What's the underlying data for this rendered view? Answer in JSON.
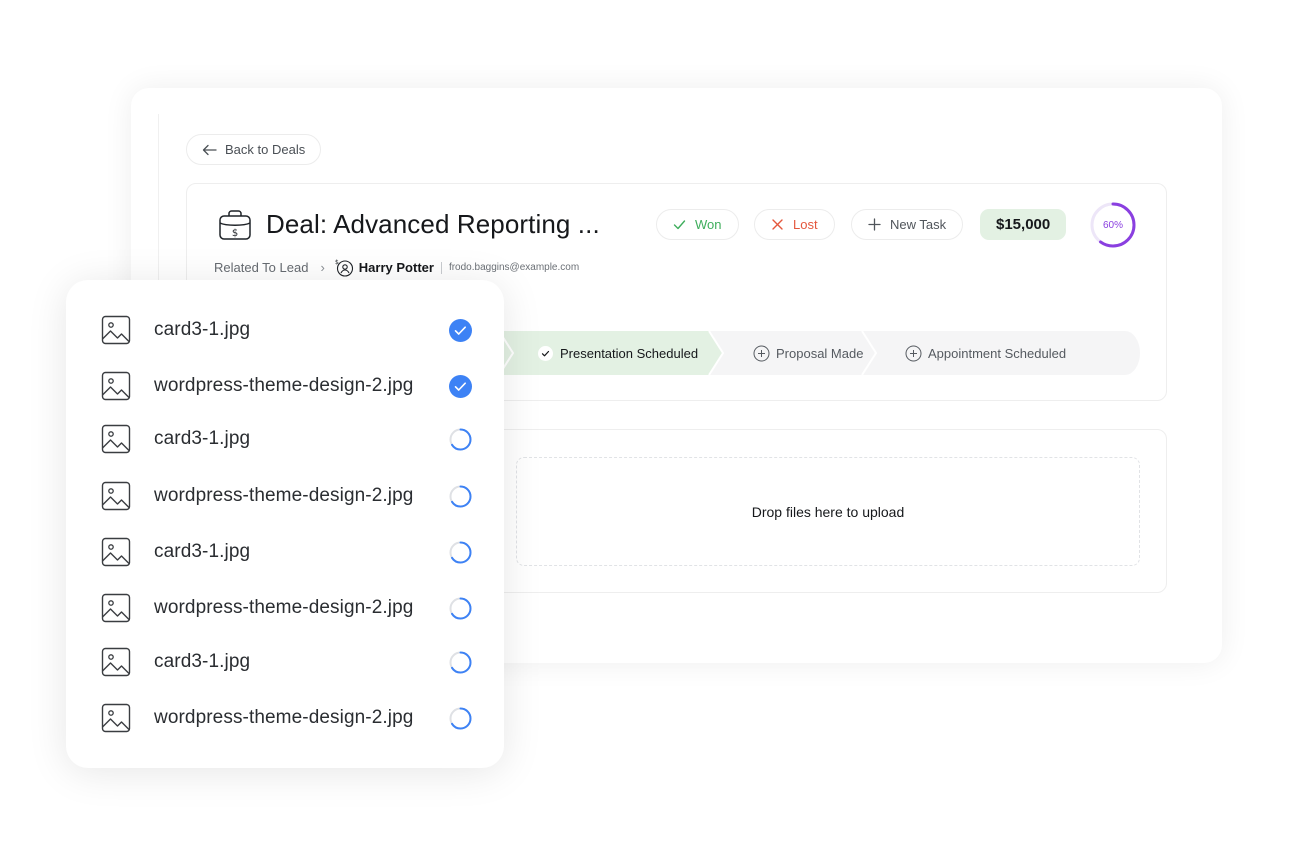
{
  "back": {
    "label": "Back to Deals"
  },
  "deal": {
    "title": "Deal: Advanced Reporting ...",
    "won_label": "Won",
    "lost_label": "Lost",
    "new_task_label": "New Task",
    "amount": "$15,000",
    "progress_label": "60%",
    "progress_fraction": 0.6
  },
  "related": {
    "prefix": "Related To Lead",
    "name": "Harry Potter",
    "email": "frodo.baggins@example.com"
  },
  "stages": [
    {
      "label": "Presentation Scheduled",
      "state": "done"
    },
    {
      "label": "Proposal Made",
      "state": "todo"
    },
    {
      "label": "Appointment Scheduled",
      "state": "todo"
    }
  ],
  "upload": {
    "drop_text": "Drop files here to upload"
  },
  "files": [
    {
      "name": "card3-1.jpg",
      "status": "done"
    },
    {
      "name": "wordpress-theme-design-2.jpg",
      "status": "done"
    },
    {
      "name": "card3-1.jpg",
      "status": "uploading"
    },
    {
      "name": "wordpress-theme-design-2.jpg",
      "status": "uploading"
    },
    {
      "name": "card3-1.jpg",
      "status": "uploading"
    },
    {
      "name": "wordpress-theme-design-2.jpg",
      "status": "uploading"
    },
    {
      "name": "card3-1.jpg",
      "status": "uploading"
    },
    {
      "name": "wordpress-theme-design-2.jpg",
      "status": "uploading"
    }
  ],
  "colors": {
    "won": "#3fae5d",
    "lost": "#e4573d",
    "amount_bg": "#e3f1e3",
    "progress": "#8a3fe0",
    "stage_done": "#e3f1e3",
    "stage_todo": "#f5f5f6",
    "status_blue": "#3d82f5"
  }
}
